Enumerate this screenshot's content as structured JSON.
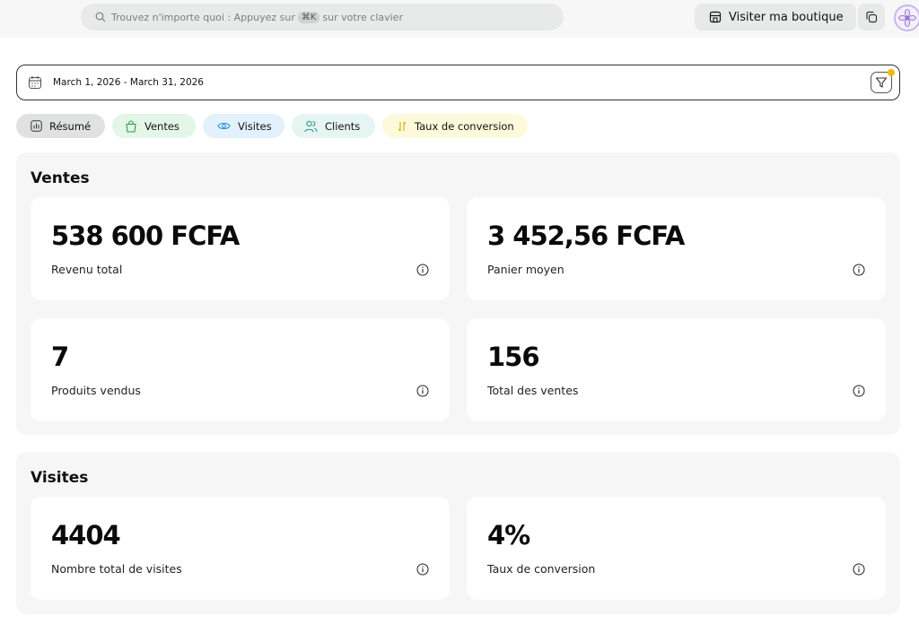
{
  "topbar": {
    "search_placeholder_pre": "Trouvez n'importe quoi : Appuyez sur",
    "search_shortcut": "⌘K",
    "search_placeholder_post": "sur votre clavier",
    "visit_label": "Visiter ma boutique"
  },
  "filter": {
    "date_range": "March 1, 2026 - March 31, 2026"
  },
  "tabs": [
    {
      "label": "Résumé"
    },
    {
      "label": "Ventes"
    },
    {
      "label": "Visites"
    },
    {
      "label": "Clients"
    },
    {
      "label": "Taux de conversion"
    }
  ],
  "sections": {
    "ventes": {
      "title": "Ventes",
      "cards": [
        {
          "value": "538 600 FCFA",
          "label": "Revenu total"
        },
        {
          "value": "3 452,56 FCFA",
          "label": "Panier moyen"
        },
        {
          "value": "7",
          "label": "Produits vendus"
        },
        {
          "value": "156",
          "label": "Total des ventes"
        }
      ]
    },
    "visites": {
      "title": "Visites",
      "cards": [
        {
          "value": "4404",
          "label": "Nombre total de visites"
        },
        {
          "value": "4%",
          "label": "Taux de conversion"
        }
      ]
    }
  },
  "colors": {
    "accent_dot": "#f5b800",
    "tab_resume": "#dfe2e1",
    "tab_ventes": "#e3f6e8",
    "tab_visites": "#e2f1fb",
    "tab_clients": "#e6f5f1",
    "tab_taux": "#fdf9db"
  },
  "icons": {
    "search": "search-icon",
    "store": "store-icon",
    "copy": "copy-icon",
    "avatar": "flower-avatar-icon",
    "calendar": "calendar-icon",
    "filter": "filter-icon",
    "info": "info-icon"
  }
}
